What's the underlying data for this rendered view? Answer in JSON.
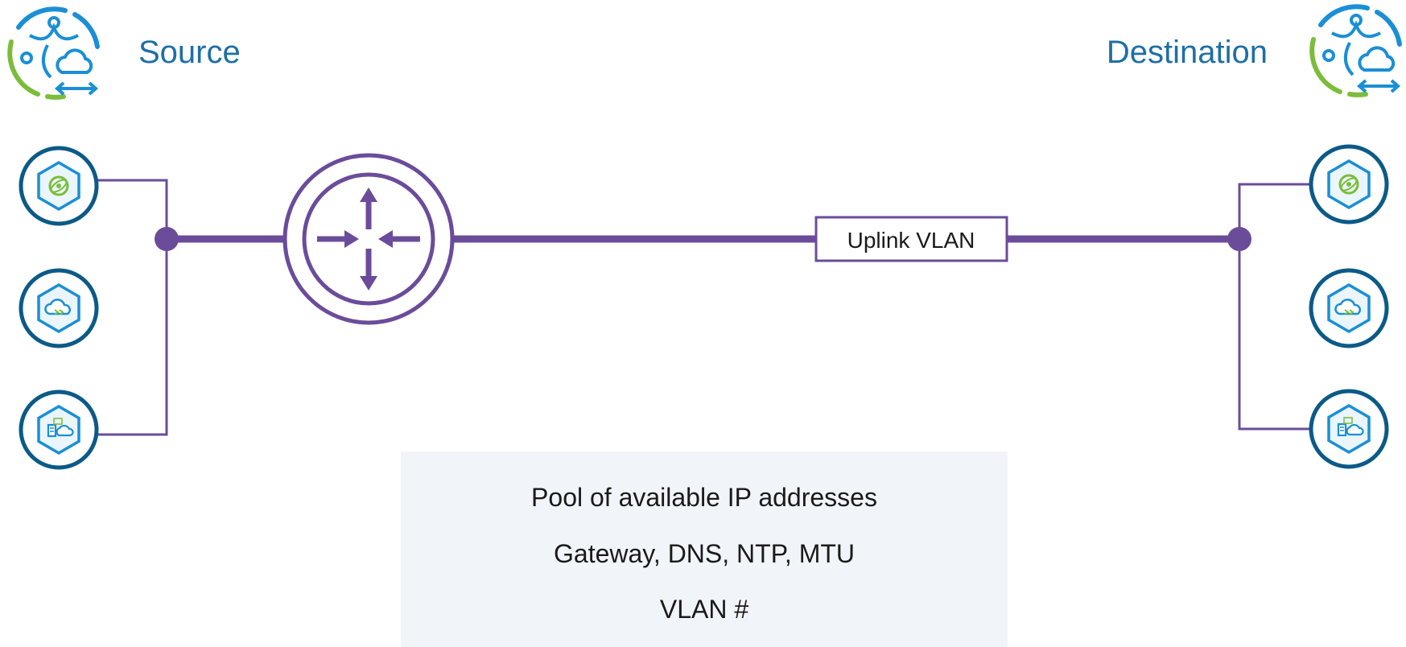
{
  "header": {
    "source_title": "Source",
    "destination_title": "Destination"
  },
  "link": {
    "label": "Uplink VLAN"
  },
  "info_box": {
    "lines": [
      "Pool of available IP addresses",
      "Gateway, DNS, NTP, MTU",
      "VLAN #"
    ]
  },
  "colors": {
    "line": "#6b4c9a",
    "node_ring": "#0b5a87",
    "icon_blue": "#1a8fd6",
    "icon_green": "#7bbd3a",
    "title": "#1d6fa5",
    "info_background": "#f1f5f9"
  },
  "icons": {
    "site_logo": "cloud-network-migration-icon",
    "source_nodes": [
      "globe-hex-icon",
      "cloud-sync-hex-icon",
      "server-cloud-hex-icon"
    ],
    "destination_nodes": [
      "globe-hex-icon",
      "cloud-sync-hex-icon",
      "server-cloud-hex-icon"
    ],
    "router": "router-arrows-icon"
  }
}
